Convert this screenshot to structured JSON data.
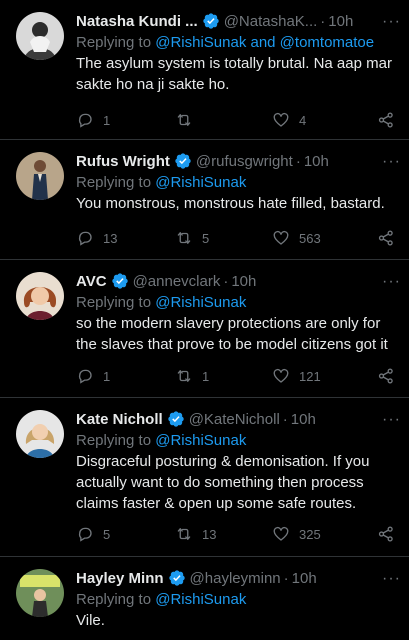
{
  "tweets": [
    {
      "name": "Natasha Kundi ...",
      "handle": "@NatashaK...",
      "time": "10h",
      "replying_prefix": "Replying to ",
      "replying_to": "@RishiSunak and @tomtomatoe",
      "text": "The asylum system is totally brutal. Na aap mar sakte ho na ji sakte ho.",
      "replies": "1",
      "retweets": "",
      "likes": "4"
    },
    {
      "name": "Rufus Wright",
      "handle": "@rufusgwright",
      "time": "10h",
      "replying_prefix": "Replying to ",
      "replying_to": "@RishiSunak",
      "text": "You monstrous, monstrous hate filled, bastard.",
      "replies": "13",
      "retweets": "5",
      "likes": "563"
    },
    {
      "name": "AVC",
      "handle": "@annevclark",
      "time": "10h",
      "replying_prefix": "Replying to ",
      "replying_to": "@RishiSunak",
      "text": "so the modern slavery protections are only for the slaves that prove to be model citizens got it",
      "replies": "1",
      "retweets": "1",
      "likes": "121"
    },
    {
      "name": "Kate Nicholl",
      "handle": "@KateNicholl",
      "time": "10h",
      "replying_prefix": "Replying to ",
      "replying_to": "@RishiSunak",
      "text": "Disgraceful posturing & demonisation. If you actually want to do something then process claims faster & open up some safe routes.",
      "replies": "5",
      "retweets": "13",
      "likes": "325"
    },
    {
      "name": "Hayley Minn",
      "handle": "@hayleyminn",
      "time": "10h",
      "replying_prefix": "Replying to ",
      "replying_to": "@RishiSunak",
      "text": "Vile.",
      "replies": "",
      "retweets": "",
      "likes": ""
    }
  ],
  "separator": "·",
  "more_glyph": "···",
  "colors": {
    "background": "#000000",
    "text": "#e7e9ea",
    "muted": "#71767b",
    "accent": "#1d9bf0",
    "divider": "#2f3336"
  }
}
